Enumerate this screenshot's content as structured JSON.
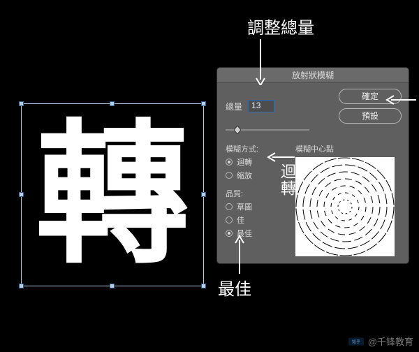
{
  "canvas": {
    "glyph": "轉"
  },
  "annotations": {
    "adjust_amount": "調整總量",
    "spin_method": "迴轉",
    "best_quality": "最佳"
  },
  "dialog": {
    "title": "放射狀模糊",
    "amount_label": "總量",
    "amount_value": "13",
    "ok_label": "確定",
    "preset_label": "預設",
    "method_label": "模糊方式:",
    "method_spin": "迴轉",
    "method_zoom": "縮放",
    "quality_label": "品質:",
    "quality_draft": "草圖",
    "quality_good": "佳",
    "quality_best": "最佳",
    "center_label": "模糊中心點"
  },
  "watermark": {
    "site": "知乎",
    "author": "@千锋教育"
  }
}
